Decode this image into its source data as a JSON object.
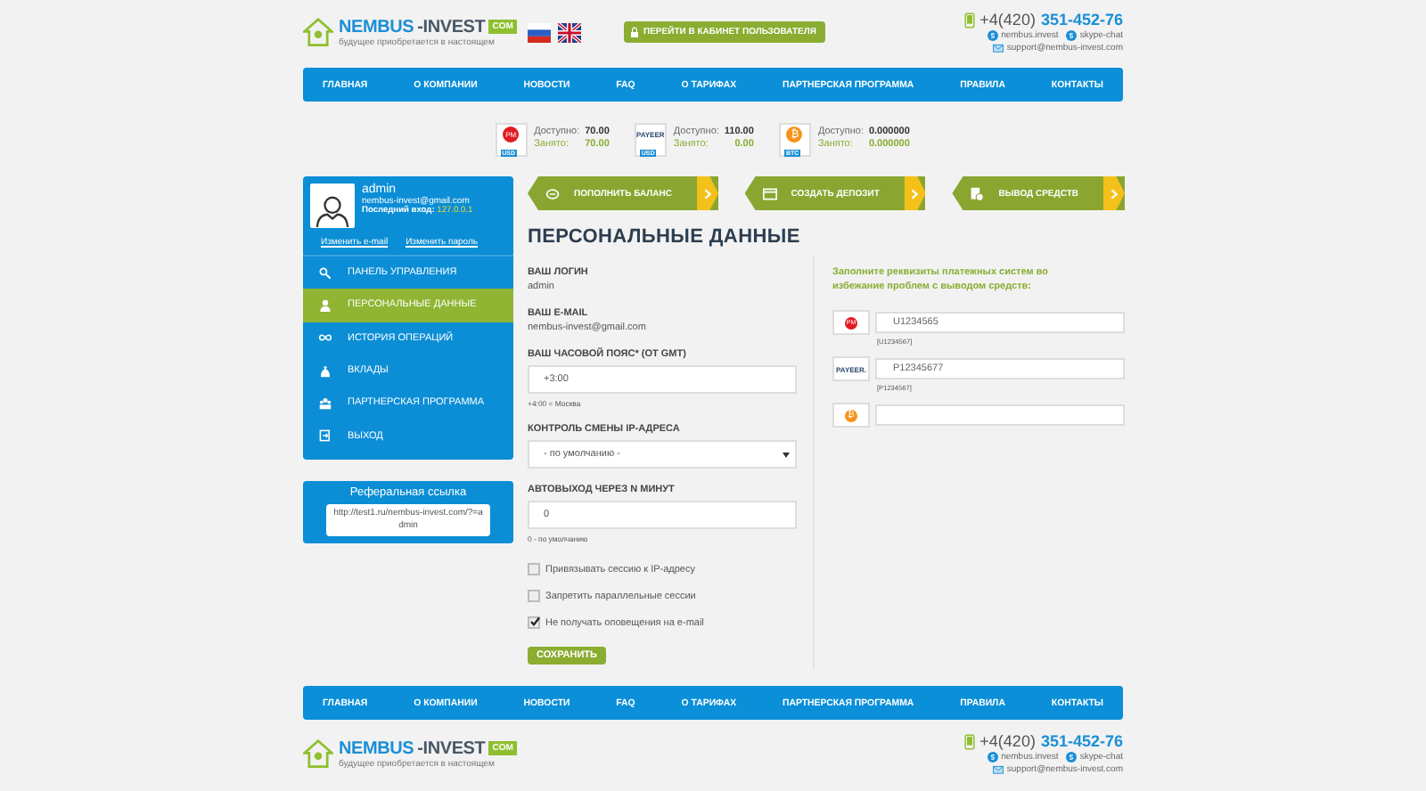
{
  "header": {
    "logo": {
      "name_main": "NEMBUS",
      "name_rest": "-INVEST",
      "domain": "COM",
      "tagline": "будущее приобретается в настоящем"
    },
    "cabinet_button": "ПЕРЕЙТИ В КАБИНЕТ ПОЛЬЗОВАТЕЛЯ",
    "contacts": {
      "phone_prefix": "+4(420)",
      "phone_number": "351-452-76",
      "skype": [
        "nembus.invest",
        "skype-chat"
      ],
      "email": "support@nembus-invest.com"
    }
  },
  "nav": [
    "ГЛАВНАЯ",
    "О КОМПАНИИ",
    "НОВОСТИ",
    "FAQ",
    "О ТАРИФАХ",
    "ПАРТНЕРСКАЯ ПРОГРАММА",
    "ПРАВИЛА",
    "КОНТАКТЫ"
  ],
  "balances": [
    {
      "kind": "pm",
      "logo": "PM",
      "currency": "USD",
      "available_label": "Доступно:",
      "available": "70.00",
      "busy_label": "Занято:",
      "busy": "70.00"
    },
    {
      "kind": "payeer",
      "logo": "PAYEER",
      "currency": "USD",
      "available_label": "Доступно:",
      "available": "110.00",
      "busy_label": "Занято:",
      "busy": "0.00"
    },
    {
      "kind": "btc",
      "logo": "₿",
      "currency": "BTC",
      "available_label": "Доступно:",
      "available": "0.000000",
      "busy_label": "Занято:",
      "busy": "0.000000"
    }
  ],
  "actions": [
    {
      "kind": "refill",
      "label": "ПОПОЛНИТЬ БАЛАНС"
    },
    {
      "kind": "deposit",
      "label": "СОЗДАТЬ ДЕПОЗИТ"
    },
    {
      "kind": "withdraw",
      "label": "ВЫВОД СРЕДСТВ"
    }
  ],
  "profile": {
    "username": "admin",
    "email": "nembus-invest@gmail.com",
    "last_login_label": "Последний вход:",
    "last_login_ip": "127.0.0.1",
    "links": [
      "Изменить e-mail",
      "Изменить пароль"
    ]
  },
  "menu": [
    {
      "kind": "dashboard",
      "label": "ПАНЕЛЬ УПРАВЛЕНИЯ",
      "selected": false
    },
    {
      "kind": "personal",
      "label": "ПЕРСОНАЛЬНЫЕ ДАННЫЕ",
      "selected": true
    },
    {
      "kind": "history",
      "label": "ИСТОРИЯ ОПЕРАЦИЙ",
      "selected": false
    },
    {
      "kind": "deposits",
      "label": "ВКЛАДЫ",
      "selected": false
    },
    {
      "kind": "partners",
      "label": "ПАРТНЕРСКАЯ ПРОГРАММА",
      "selected": false
    },
    {
      "kind": "exit",
      "label": "ВЫХОД",
      "selected": false
    }
  ],
  "referral": {
    "title": "Реферальная ссылка",
    "link": "http://test1.ru/nembus-invest.com/?=admin"
  },
  "form": {
    "title": "ПЕРСОНАЛЬНЫЕ ДАННЫЕ",
    "fields": [
      {
        "kind": "static",
        "label": "ВАШ ЛОГИН",
        "value": "admin"
      },
      {
        "kind": "static",
        "label": "ВАШ E-MAIL",
        "value": "nembus-invest@gmail.com"
      },
      {
        "kind": "input",
        "label": "ВАШ ЧАСОВОЙ ПОЯС* (ОТ GMT)",
        "value": "+3:00",
        "hint": "+4:00 = Москва"
      },
      {
        "kind": "select",
        "label": "КОНТРОЛЬ СМЕНЫ IP-АДРЕСА",
        "value": "- по умолчанию -"
      },
      {
        "kind": "input",
        "label": "АВТОВЫХОД ЧЕРЕЗ N МИНУТ",
        "value": "0",
        "hint": "0 - по умолчанию"
      },
      {
        "kind": "checkbox",
        "label": "Привязывать сессию к IP-адресу",
        "checked": false
      },
      {
        "kind": "checkbox",
        "label": "Запретить параллельные сессии",
        "checked": false
      },
      {
        "kind": "checkbox",
        "label": "Не получать оповещения на e-mail",
        "checked": true
      }
    ],
    "save_button": "СОХРАНИТЬ"
  },
  "wallets": {
    "note": "Заполните реквизиты платежных систем во избежание проблем с выводом средств:",
    "items": [
      {
        "kind": "pm",
        "logo": "PM",
        "value": "U1234565",
        "hint": "[U1234567]"
      },
      {
        "kind": "payeer",
        "logo": "PAYEER.",
        "value": "P12345677",
        "hint": "[P1234567]"
      },
      {
        "kind": "btc",
        "logo": "₿"
      }
    ]
  },
  "footer": {
    "nav": [
      "ГЛАВНАЯ",
      "О КОМПАНИИ",
      "НОВОСТИ",
      "FAQ",
      "О ТАРИФАХ",
      "ПАРТНЕРСКАЯ ПРОГРАММА",
      "ПРАВИЛА",
      "КОНТАКТЫ"
    ],
    "logo": {
      "name_main": "NEMBUS",
      "name_rest": "-INVEST",
      "domain": "COM",
      "tagline": "будущее приобретается в настоящем"
    },
    "contacts": {
      "phone_prefix": "+4(420)",
      "phone_number": "351-452-76",
      "skype": [
        "nembus.invest",
        "skype-chat"
      ],
      "email": "support@nembus-invest.com"
    }
  }
}
